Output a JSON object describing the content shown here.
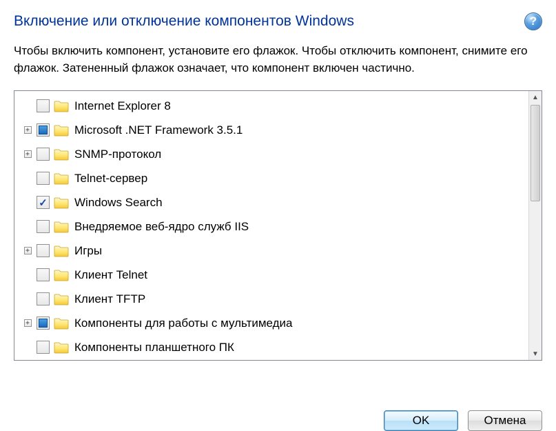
{
  "title": "Включение или отключение компонентов Windows",
  "help_glyph": "?",
  "description": "Чтобы включить компонент, установите его флажок. Чтобы отключить компонент, снимите его флажок. Затененный флажок означает, что компонент включен частично.",
  "items": [
    {
      "label": "Internet Explorer 8",
      "expandable": false,
      "check": "unchecked"
    },
    {
      "label": "Microsoft .NET Framework 3.5.1",
      "expandable": true,
      "check": "partial"
    },
    {
      "label": "SNMP-протокол",
      "expandable": true,
      "check": "unchecked"
    },
    {
      "label": "Telnet-сервер",
      "expandable": false,
      "check": "unchecked"
    },
    {
      "label": "Windows Search",
      "expandable": false,
      "check": "checked"
    },
    {
      "label": "Внедряемое веб-ядро служб IIS",
      "expandable": false,
      "check": "unchecked"
    },
    {
      "label": "Игры",
      "expandable": true,
      "check": "unchecked"
    },
    {
      "label": "Клиент Telnet",
      "expandable": false,
      "check": "unchecked"
    },
    {
      "label": "Клиент TFTP",
      "expandable": false,
      "check": "unchecked"
    },
    {
      "label": "Компоненты для работы с мультимедиа",
      "expandable": true,
      "check": "partial"
    },
    {
      "label": "Компоненты планшетного ПК",
      "expandable": false,
      "check": "unchecked"
    }
  ],
  "buttons": {
    "ok": "OK",
    "cancel": "Отмена"
  },
  "expander_glyph": "+"
}
